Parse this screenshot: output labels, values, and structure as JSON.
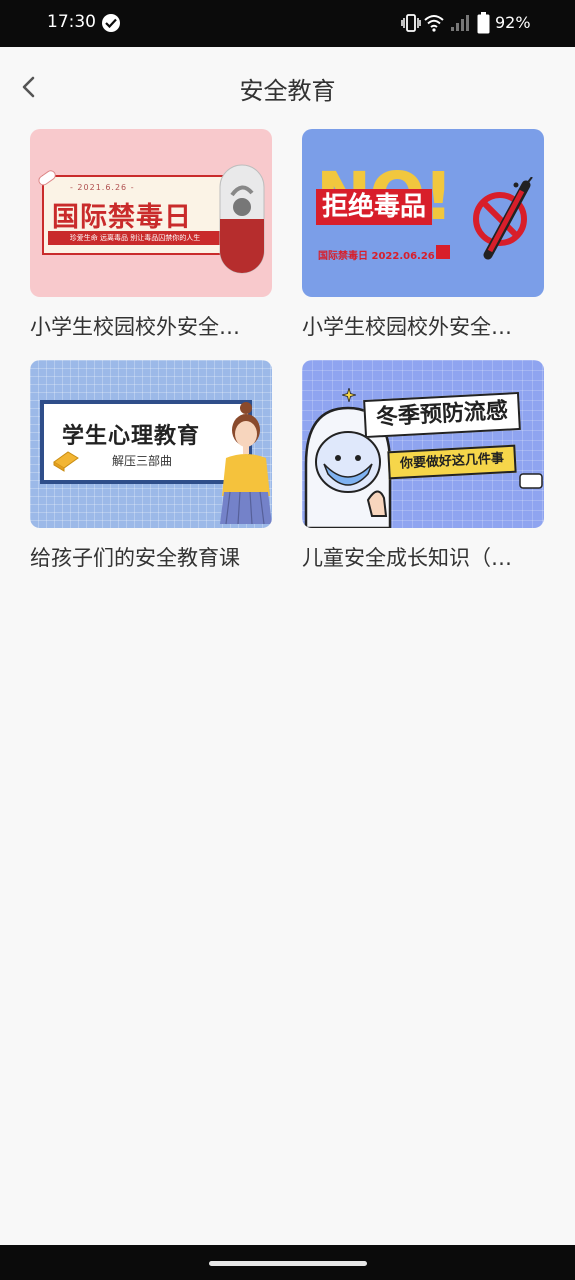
{
  "status_bar": {
    "time": "17:30",
    "battery": "92%",
    "icons": [
      "check-circle-icon",
      "vibrate-icon",
      "wifi-icon",
      "signal-icon",
      "battery-icon"
    ]
  },
  "header": {
    "title": "安全教育",
    "back_icon": "chevron-left-icon"
  },
  "items": [
    {
      "title": "小学生校园校外安全…",
      "thumb": {
        "bg": "#f8c9cc",
        "date": "- 2021.6.26 -",
        "headline": "国际禁毒日",
        "tagline": "珍爱生命 远离毒品 别让毒品囚禁你的人生"
      }
    },
    {
      "title": "小学生校园校外安全…",
      "thumb": {
        "bg": "#7b9ee8",
        "big": "NO!",
        "headline": "拒绝毒品",
        "subline": "国际禁毒日 2022.06.26"
      }
    },
    {
      "title": "给孩子们的安全教育课",
      "thumb": {
        "bg": "#9cb9e8",
        "headline": "学生心理教育",
        "subline": "解压三部曲"
      }
    },
    {
      "title": "儿童安全成长知识（…",
      "thumb": {
        "bg": "#8fa4f0",
        "headline": "冬季预防流感",
        "subline": "你要做好这几件事"
      }
    }
  ]
}
